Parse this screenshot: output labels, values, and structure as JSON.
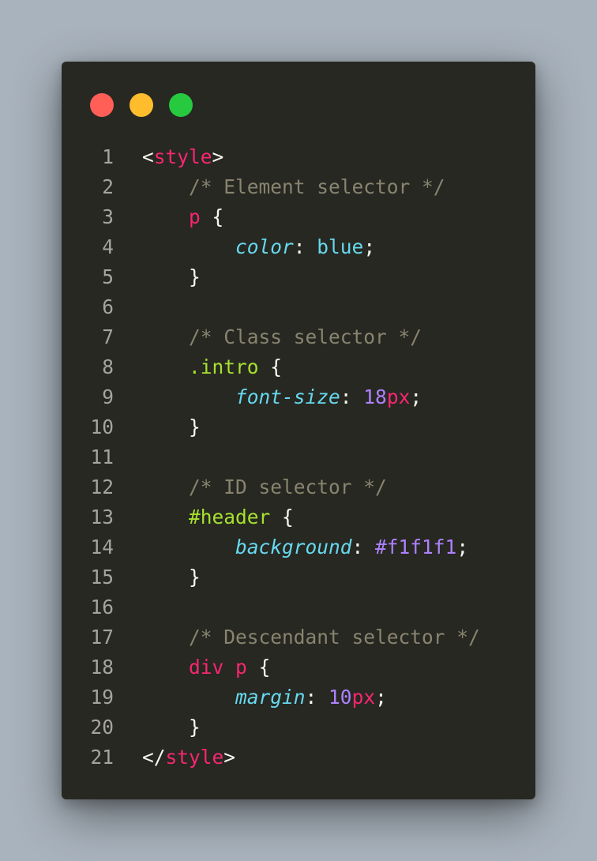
{
  "window": {
    "controls": {
      "close_color": "#ff5f56",
      "minimize_color": "#ffbd2e",
      "maximize_color": "#27c93f"
    }
  },
  "lines": [
    {
      "number": "1",
      "tokens": [
        {
          "t": "<",
          "c": "punct"
        },
        {
          "t": "style",
          "c": "tag"
        },
        {
          "t": ">",
          "c": "punct"
        }
      ]
    },
    {
      "number": "2",
      "tokens": [
        {
          "t": "    ",
          "c": "punct"
        },
        {
          "t": "/* Element selector */",
          "c": "comment"
        }
      ]
    },
    {
      "number": "3",
      "tokens": [
        {
          "t": "    ",
          "c": "punct"
        },
        {
          "t": "p",
          "c": "selector"
        },
        {
          "t": " {",
          "c": "punct"
        }
      ]
    },
    {
      "number": "4",
      "tokens": [
        {
          "t": "        ",
          "c": "punct"
        },
        {
          "t": "color",
          "c": "prop"
        },
        {
          "t": ": ",
          "c": "punct"
        },
        {
          "t": "blue",
          "c": "value"
        },
        {
          "t": ";",
          "c": "punct"
        }
      ]
    },
    {
      "number": "5",
      "tokens": [
        {
          "t": "    }",
          "c": "punct"
        }
      ]
    },
    {
      "number": "6",
      "tokens": []
    },
    {
      "number": "7",
      "tokens": [
        {
          "t": "    ",
          "c": "punct"
        },
        {
          "t": "/* Class selector */",
          "c": "comment"
        }
      ]
    },
    {
      "number": "8",
      "tokens": [
        {
          "t": "    ",
          "c": "punct"
        },
        {
          "t": ".intro",
          "c": "classsel"
        },
        {
          "t": " {",
          "c": "punct"
        }
      ]
    },
    {
      "number": "9",
      "tokens": [
        {
          "t": "        ",
          "c": "punct"
        },
        {
          "t": "font-size",
          "c": "prop"
        },
        {
          "t": ": ",
          "c": "punct"
        },
        {
          "t": "18",
          "c": "number"
        },
        {
          "t": "px",
          "c": "unit"
        },
        {
          "t": ";",
          "c": "punct"
        }
      ]
    },
    {
      "number": "10",
      "tokens": [
        {
          "t": "    }",
          "c": "punct"
        }
      ]
    },
    {
      "number": "11",
      "tokens": []
    },
    {
      "number": "12",
      "tokens": [
        {
          "t": "    ",
          "c": "punct"
        },
        {
          "t": "/* ID selector */",
          "c": "comment"
        }
      ]
    },
    {
      "number": "13",
      "tokens": [
        {
          "t": "    ",
          "c": "punct"
        },
        {
          "t": "#header",
          "c": "classsel"
        },
        {
          "t": " {",
          "c": "punct"
        }
      ]
    },
    {
      "number": "14",
      "tokens": [
        {
          "t": "        ",
          "c": "punct"
        },
        {
          "t": "background",
          "c": "prop"
        },
        {
          "t": ": ",
          "c": "punct"
        },
        {
          "t": "#f1f1f1",
          "c": "number"
        },
        {
          "t": ";",
          "c": "punct"
        }
      ]
    },
    {
      "number": "15",
      "tokens": [
        {
          "t": "    }",
          "c": "punct"
        }
      ]
    },
    {
      "number": "16",
      "tokens": []
    },
    {
      "number": "17",
      "tokens": [
        {
          "t": "    ",
          "c": "punct"
        },
        {
          "t": "/* Descendant selector */",
          "c": "comment"
        }
      ]
    },
    {
      "number": "18",
      "tokens": [
        {
          "t": "    ",
          "c": "punct"
        },
        {
          "t": "div",
          "c": "selector"
        },
        {
          "t": " ",
          "c": "punct"
        },
        {
          "t": "p",
          "c": "selector"
        },
        {
          "t": " {",
          "c": "punct"
        }
      ]
    },
    {
      "number": "19",
      "tokens": [
        {
          "t": "        ",
          "c": "punct"
        },
        {
          "t": "margin",
          "c": "prop"
        },
        {
          "t": ": ",
          "c": "punct"
        },
        {
          "t": "10",
          "c": "number"
        },
        {
          "t": "px",
          "c": "unit"
        },
        {
          "t": ";",
          "c": "punct"
        }
      ]
    },
    {
      "number": "20",
      "tokens": [
        {
          "t": "    }",
          "c": "punct"
        }
      ]
    },
    {
      "number": "21",
      "tokens": [
        {
          "t": "</",
          "c": "punct"
        },
        {
          "t": "style",
          "c": "tag"
        },
        {
          "t": ">",
          "c": "punct"
        }
      ]
    }
  ]
}
